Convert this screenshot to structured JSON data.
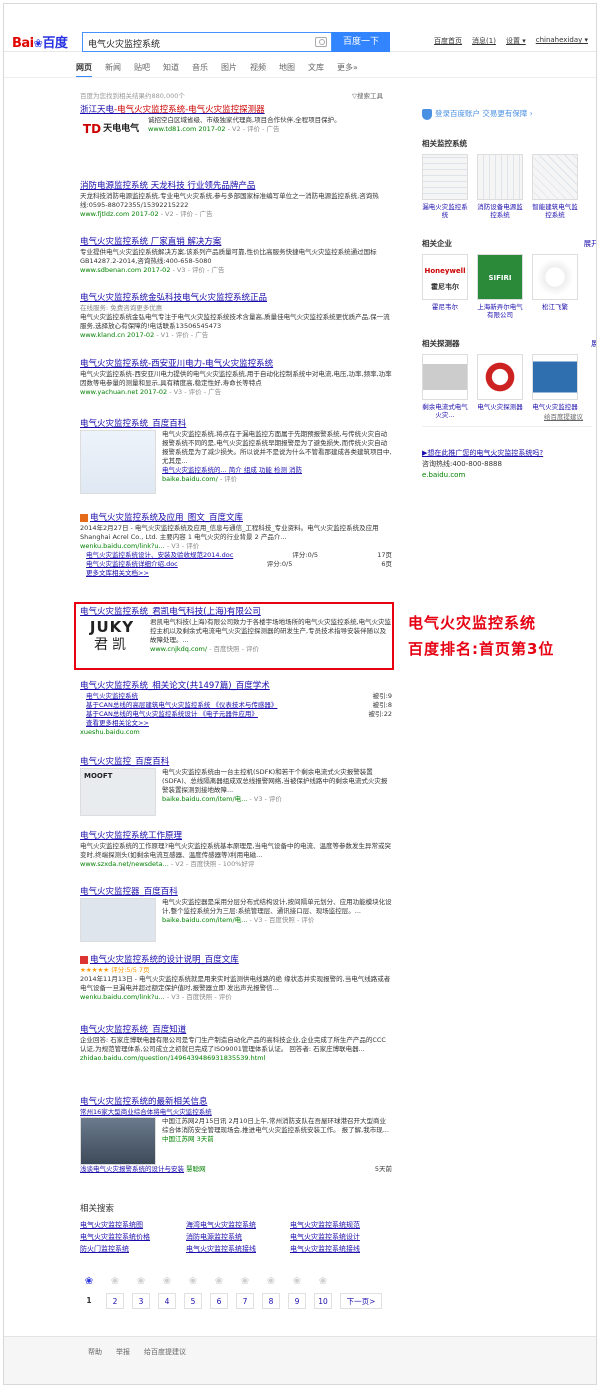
{
  "header": {
    "logo_part1": "Bai",
    "logo_paw": "❀",
    "logo_part2": "百度",
    "query": "电气火灾监控系统",
    "search_button": "百度一下",
    "links": [
      "百度首页",
      "消息(1)",
      "设置 ▾",
      "chinahexiday ▾"
    ]
  },
  "tabs": [
    "网页",
    "新闻",
    "贴吧",
    "知道",
    "音乐",
    "图片",
    "视频",
    "地图",
    "文库",
    "更多»"
  ],
  "meta": {
    "result_count": "百度为您找到相关结果约880,000个",
    "search_tools": "▽搜索工具"
  },
  "results": [
    {
      "title_pre": "浙江天电",
      "title": "-电气火灾监控系统-电气火灾监控探测器",
      "desc": "诚招空白区域省级、市级独家代理商,项目合作伙伴,全程项目保护。",
      "url": "www.td81.com 2017-02",
      "tail": " - V2 - 评价 - 广告",
      "logo_text": "天电电气"
    },
    {
      "title": "消防电源监控系统 天龙科技 行业领先品牌产品",
      "desc": "天龙科技消防电源监控系统,专业电气火灾系统,参与多部国家标准编写单位之一消防电源监控系统,咨询热线:0595-88072355/15392215222",
      "url": "www.fjtldz.com 2017-02",
      "tail": " - V2 - 评价 - 广告"
    },
    {
      "title": "电气火灾监控系统 厂家直销 解决方案",
      "desc": "专业提供电气火灾监控系统解决方案,该系列产品质量可靠,性价比高服务快捷电气火灾监控系统通过国标GB14287.2-2014,咨询热线:400-658-5080",
      "url": "www.sdbenan.com 2017-02",
      "tail": " - V3 - 评价 - 广告"
    },
    {
      "title": "电气火灾监控系统金弘科技电气火灾监控系统正品",
      "desc_head": "在线服务: 免费咨询更多优惠",
      "desc": "电气火灾监控系统金弘电气专注于电气火灾监控系统技术含量高,质量佳电气火灾监控系统更优质产品,保一流服务,选择放心有保障的!电话联系13506545473",
      "url": "www.kland.cn 2017-02",
      "tail": " - V1 - 评价 - 广告"
    },
    {
      "title": "电气火灾监控系统-西安亚川电力-电气火灾监控系统",
      "desc": "电气火灾监控系统-西安亚川电力提供的电气火灾监控系统,用于自动化控制系统中对电流,电压,功率,频率,功率因数等电参量的测量和显示,具有精度高,稳定性好,寿命长等特点",
      "url": "www.yachuan.net 2017-02",
      "tail": " - V3 - 评价 - 广告"
    },
    {
      "title": "电气火灾监控系统_百度百科",
      "desc": "电气火灾监控系统,将点在于漏电监控方面属于先期预报警系统,与传统火灾自动报警系统不同的是,电气火灾监控系统早期报警是为了避免损失,而传统火灾自动报警系统是为了减少损失。所以说并不是说为什么不管看那建成各类建筑项目中,尤其是...",
      "links": "电气火灾监控系统的... 简介 组成 功能 检测 消防",
      "url": "baike.baidu.com/",
      "tail": " - 评价"
    },
    {
      "title": "电气火灾监控系统及应用_图文_百度文库",
      "desc": "2014年2月27日 - 电气火灾监控系统及应用_信息与通信_工程科技_专业资料。电气火灾监控系统及应用 Shanghai Acrel Co., Ltd. 主要内容 1 电气火灾的行业背景 2 产品介...",
      "url": "wenku.baidu.com/link?u...",
      "tail": " - V3 - 评价",
      "sub": [
        {
          "link": "电气火灾监控系统设计、安装及验收规范2014.doc",
          "score": "评分:0/5",
          "pages": "17页"
        },
        {
          "link": "电气火灾监控系统详细介绍.doc",
          "score": "评分:0/5",
          "pages": "6页"
        },
        {
          "link": "更多文库相关文档>>",
          "score": "",
          "pages": ""
        }
      ]
    },
    {
      "title": "电气火灾监控系统_君凯电气科技(上海)有限公司",
      "desc": "君凯电气科技(上海)有限公司致力于各楼宇场地场所的电气火灾监控系统,电气火灾监控主机以及剩余式电流电气火灾监控探测器的研发生产,专员技术指导安装伴随以及故障处理。...",
      "url": "www.cnjkdq.com/",
      "tail": " - 百度快照 - 评价",
      "logo1": "JUKY",
      "logo2": "君凯"
    },
    {
      "title": "电气火灾监控系统_相关论文(共1497篇)_百度学术",
      "sub": [
        {
          "link": "电气火灾监控系统",
          "score": "",
          "pages": "被引:9"
        },
        {
          "link": "基于CAN总线的高层建筑电气火灾监控系统 《仪表技术与传感器》",
          "score": "",
          "pages": "被引:8"
        },
        {
          "link": "基于CAN总线的电气火灾监控系统设计 《电子元器件应用》",
          "score": "",
          "pages": "被引:22"
        },
        {
          "link": "查看更多相关论文>>",
          "score": "",
          "pages": ""
        }
      ],
      "url": "xueshu.baidu.com"
    },
    {
      "title": "电气火灾监控_百度百科",
      "desc": "电气火灾监控系统由一台主控机(SDFK)和若干个剩余电流式火灾报警装置(SDFA)、总线隔离器组成双总线报警网络,当被保护线路中的剩余电流式火灾报警装置探测到接地故障...",
      "url": "baike.baidu.com/item/电...",
      "tail": " - V3 - 评价",
      "thumb_label": "MOOFT"
    },
    {
      "title": "电气火灾监控系统工作原理",
      "desc": "电气火灾监控系统的工作原理?电气火灾监控系统基本原理是,当电气设备中的电流、温度等参数发生异常或突变时,终端探测头(如剩余电流互感器、温度传感器等)利用电磁...",
      "url": "www.szxda.net/newsdeta...",
      "tail": " - V2 - 百度快照 - 100%好评"
    },
    {
      "title": "电气火灾监控器_百度百科",
      "desc": "电气火灾监控器是采用分层分布式结构设计,按间隔单元划分、应用功能模块化设计,整个监控系统分为三层:系统管理层、通讯接口层、现场监控层。...",
      "url": "baike.baidu.com/item/电...",
      "tail": " - V3 - 百度快照 - 评价"
    },
    {
      "title": "电气火灾监控系统的设计说明_百度文库",
      "stars": "★★★★★ 评分:5/5 7页",
      "desc": "2014年11月13日 - 电气火灾监控系统就是用来实时监测供电线路的绝 缘状态并实现报警的,当电气线路或者电气设备一旦漏电并超过额定保护值时,报警器立即 发出声光报警信...",
      "url": "wenku.baidu.com/link?u...",
      "tail": " - V3 - 百度快照 - 评价"
    },
    {
      "title": "电气火灾监控系统_百度知道",
      "desc": "企业回答: 石家庄博联电器有限公司是专门生产制造自动化产品的高科技企业,企业完成了所生产产品的CCC认证,为规范管理体系,公司成立之初就已完成了ISO9001管理体系认证。 回答者: 石家庄博联电器...",
      "url": "zhidao.baidu.com/question/1496439486931835539.html",
      "tail": ""
    },
    {
      "title": "电气火灾监控系统的最新相关信息",
      "news_head": "常州16家大型商业综合体将电气火灾监控系统",
      "desc": "中国江苏网2月15日讯 2月10日上午,常州消防支队在吾屋环球港召开大型商业综合体消防安全管理现场会,推进电气火灾监控系统安装工作。 报了解,我市现...",
      "source": "中国江苏网 3天前",
      "news2": "浅谈电气火灾报警系统的设计与安装",
      "news2_src": "慧聪网",
      "news2_time": "5天前"
    }
  ],
  "annotation": {
    "line1": "电气火灾监控系统",
    "line2": "百度排名:首页第3位"
  },
  "right": {
    "trust": "登录百度账户 交易更有保障 ›",
    "monitor_title": "相关监控系统",
    "expand": "展开 ›",
    "monitor_items": [
      {
        "label": "漏电火灾监控系统"
      },
      {
        "label": "消防设备电源监控系统"
      },
      {
        "label": "智能建筑电气监控系统"
      }
    ],
    "company_title": "相关企业",
    "company_items": [
      {
        "label": "霍尼韦尔",
        "logo": "Honeywell",
        "logo2": "霍尼韦尔"
      },
      {
        "label": "上海新弄尔电气有限公司",
        "logo": "SIFIRI"
      },
      {
        "label": "松江飞繁",
        "logo": ""
      }
    ],
    "detector_title": "相关探测器",
    "detector_items": [
      {
        "label": "剩余电流式电气火灾..."
      },
      {
        "label": "电气火灾探测器"
      },
      {
        "label": "电气火灾监控器"
      }
    ],
    "feedback": "给百度提建议",
    "ad_title": "▶想在此推广您的电气火灾监控系统吗?",
    "ad_phone": "咨询热线:400-800-8888",
    "ad_url": "e.baidu.com"
  },
  "related": {
    "title": "相关搜索",
    "items": [
      "电气火灾监控系统图",
      "海湾电气火灾监控系统",
      "电气火灾监控系统规范",
      "电气火灾监控系统价格",
      "消防电源监控系统",
      "电气火灾监控系统设计",
      "防火门监控系统",
      "电气火灾监控系统接线",
      "电气火灾监控系统接线"
    ]
  },
  "pager": {
    "pages": [
      "1",
      "2",
      "3",
      "4",
      "5",
      "6",
      "7",
      "8",
      "9",
      "10"
    ],
    "next": "下一页>"
  },
  "footer": {
    "links": [
      "帮助",
      "举报",
      "给百度提建议"
    ]
  },
  "colors": {
    "link": "#1a0dab",
    "highlight": "#e60012",
    "url_green": "#008000",
    "button_blue": "#3385ff"
  }
}
